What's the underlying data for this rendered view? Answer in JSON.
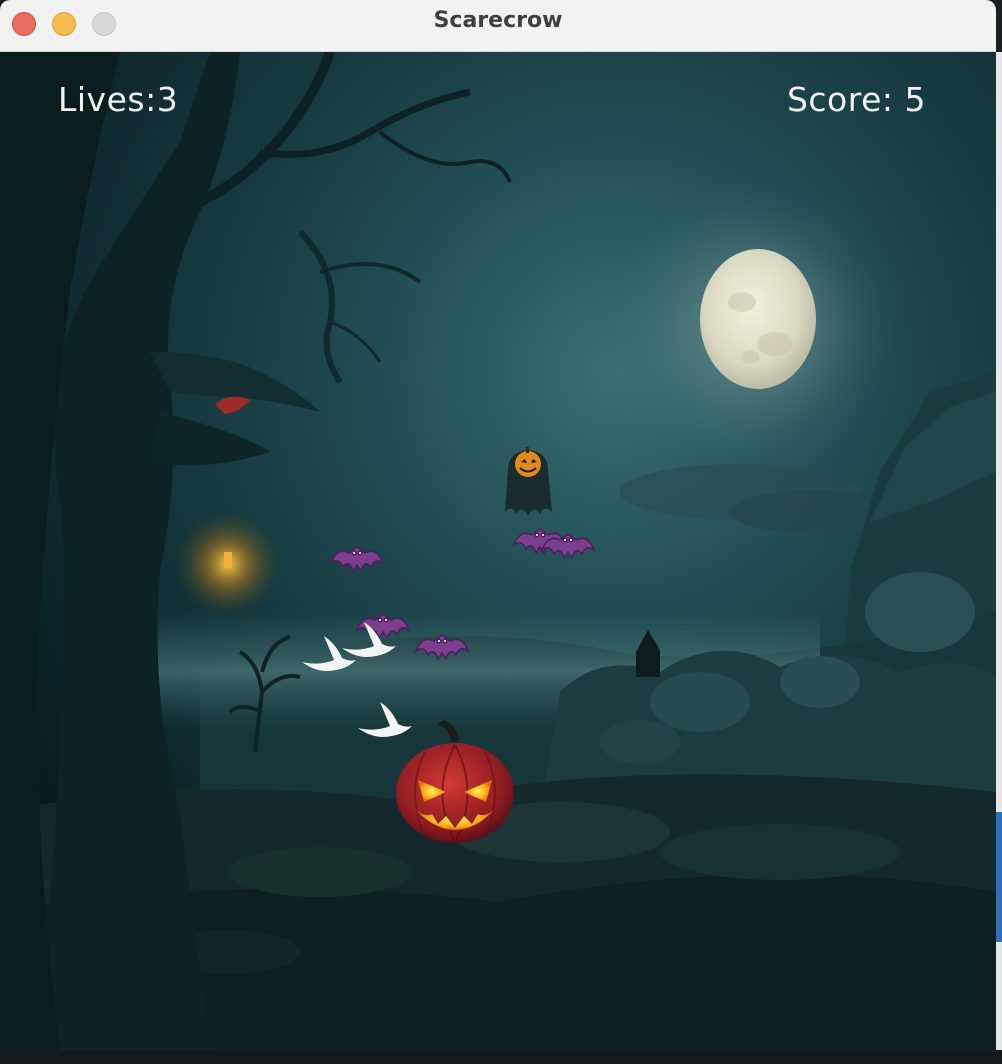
{
  "window": {
    "title": "Scarecrow"
  },
  "hud": {
    "lives_text": "Lives:3",
    "score_text": "Score: 5"
  },
  "sprites": {
    "player": "jack-o-lantern-pumpkin",
    "enemies": [
      "bat",
      "bat",
      "bat",
      "bat",
      "bat"
    ],
    "ghosts": [
      "ghost-bird",
      "ghost-bird",
      "ghost-bird"
    ],
    "reaper": "pumpkin-head-reaper"
  },
  "colors": {
    "sky_dark": "#0b1c20",
    "sky_mid": "#1f4a50",
    "moon": "#e8e4cf",
    "pumpkin": "#b5262a",
    "pumpkin_glow": "#ffb21a",
    "bat": "#8a4a9c",
    "hud_text": "#f2f2f2"
  }
}
